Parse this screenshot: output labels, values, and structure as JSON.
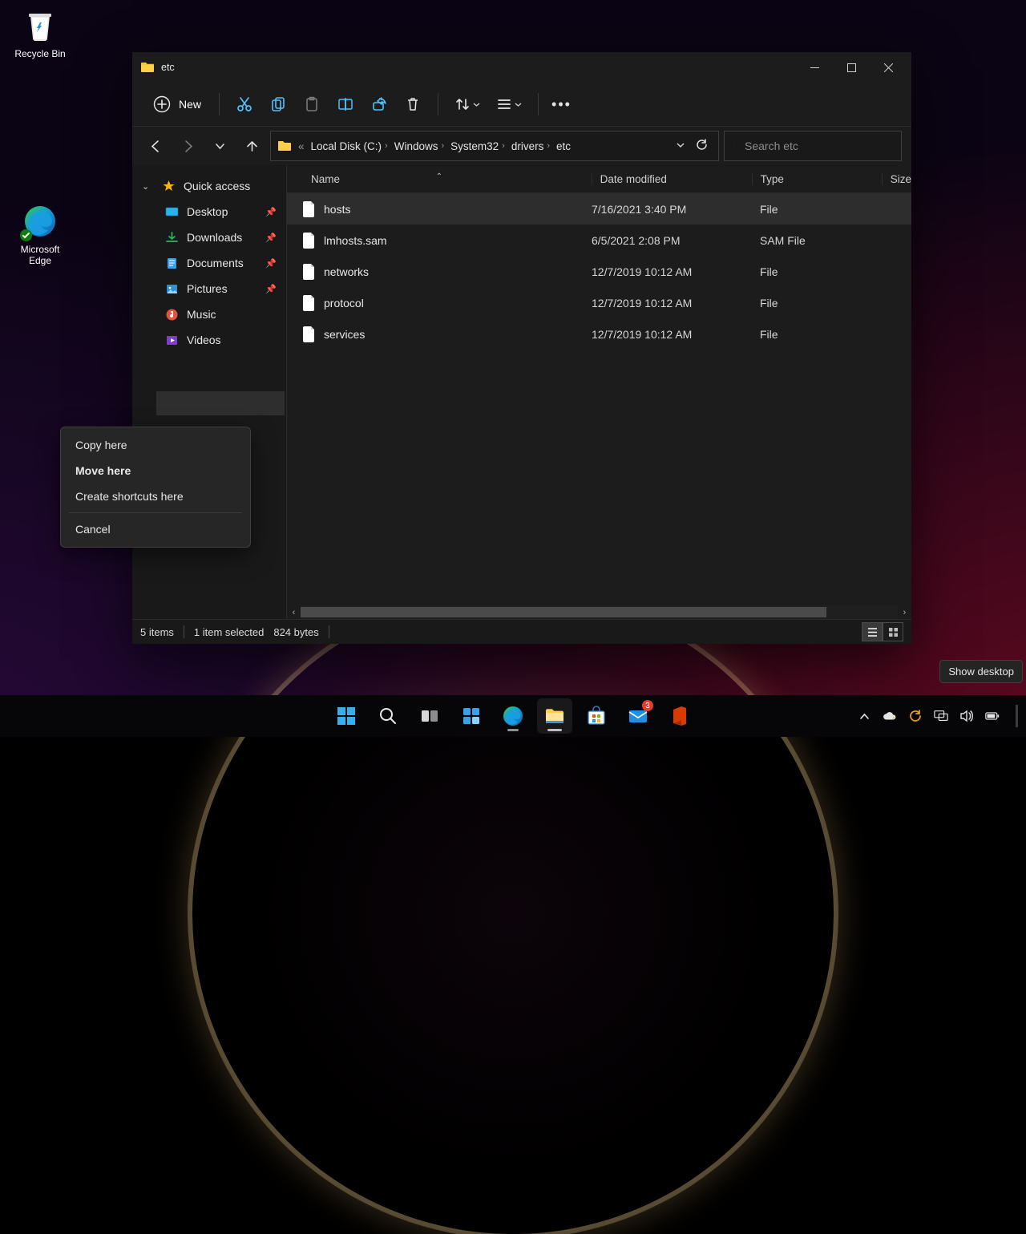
{
  "desktop": {
    "recycle_bin": "Recycle Bin",
    "edge_l1": "Microsoft",
    "edge_l2": "Edge"
  },
  "explorer": {
    "title": "etc",
    "toolbar": {
      "new_label": "New"
    },
    "breadcrumb": {
      "ellipsis": "«",
      "items": [
        {
          "label": "Local Disk (C:)"
        },
        {
          "label": "Windows"
        },
        {
          "label": "System32"
        },
        {
          "label": "drivers"
        },
        {
          "label": "etc"
        }
      ]
    },
    "search_placeholder": "Search etc",
    "navpane": {
      "quick_access": "Quick access",
      "items": [
        {
          "label": "Desktop",
          "pinned": true
        },
        {
          "label": "Downloads",
          "pinned": true
        },
        {
          "label": "Documents",
          "pinned": true
        },
        {
          "label": "Pictures",
          "pinned": true
        },
        {
          "label": "Music",
          "pinned": false
        },
        {
          "label": "Videos",
          "pinned": false
        }
      ]
    },
    "columns": {
      "name": "Name",
      "date": "Date modified",
      "type": "Type",
      "size": "Size"
    },
    "rows": [
      {
        "name": "hosts",
        "date": "7/16/2021 3:40 PM",
        "type": "File",
        "selected": true
      },
      {
        "name": "lmhosts.sam",
        "date": "6/5/2021 2:08 PM",
        "type": "SAM File",
        "selected": false
      },
      {
        "name": "networks",
        "date": "12/7/2019 10:12 AM",
        "type": "File",
        "selected": false
      },
      {
        "name": "protocol",
        "date": "12/7/2019 10:12 AM",
        "type": "File",
        "selected": false
      },
      {
        "name": "services",
        "date": "12/7/2019 10:12 AM",
        "type": "File",
        "selected": false
      }
    ],
    "status": {
      "items": "5 items",
      "selected": "1 item selected",
      "bytes": "824 bytes"
    }
  },
  "context_menu": {
    "copy": "Copy here",
    "move": "Move here",
    "shortcut": "Create shortcuts here",
    "cancel": "Cancel"
  },
  "tooltip": "Show desktop",
  "taskbar": {
    "mail_badge": "3"
  }
}
